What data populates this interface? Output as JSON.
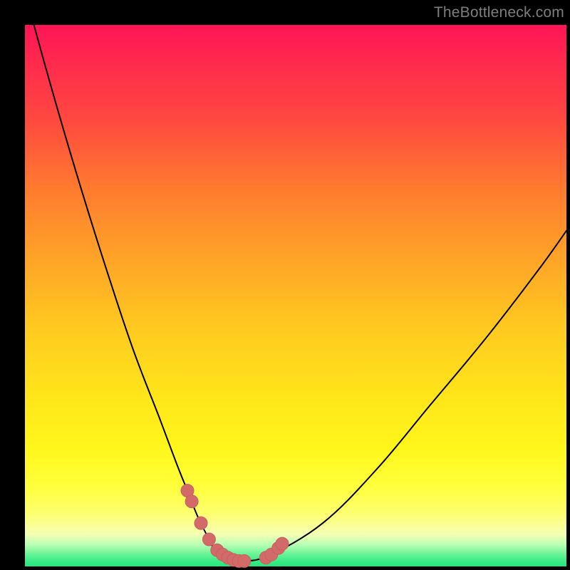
{
  "watermark": "TheBottleneck.com",
  "colors": {
    "frame": "#000000",
    "curve_stroke": "#000000",
    "marker_fill": "#d36a6a",
    "marker_stroke": "#c85f5f"
  },
  "chart_data": {
    "type": "line",
    "title": "",
    "xlabel": "",
    "ylabel": "",
    "xlim": [
      0,
      100
    ],
    "ylim": [
      0,
      100
    ],
    "grid": false,
    "legend": false,
    "note": "Axes are implied (no tick labels visible). x and y in percent of plot area; y=0 at bottom, y=100 at top.",
    "series": [
      {
        "name": "bottleneck-curve",
        "x": [
          0,
          5,
          10,
          15,
          20,
          25,
          28,
          30,
          32,
          34,
          35,
          36,
          38,
          40,
          45,
          55,
          65,
          75,
          85,
          95,
          100
        ],
        "y": [
          106,
          88,
          71,
          55,
          40,
          27,
          19,
          14,
          9,
          5,
          3,
          2,
          1,
          1,
          2,
          8,
          18,
          30,
          42,
          55,
          62
        ]
      }
    ],
    "markers": {
      "name": "highlight-points",
      "x": [
        30.0,
        30.8,
        32.5,
        34.0,
        35.5,
        36.5,
        37.5,
        38.5,
        39.5,
        40.5,
        44.5,
        45.5,
        46.8,
        47.5
      ],
      "y": [
        14.0,
        12.0,
        8.0,
        5.0,
        3.0,
        2.2,
        1.6,
        1.2,
        1.0,
        1.0,
        1.6,
        2.2,
        3.4,
        4.2
      ],
      "radius_px": 9
    },
    "background_gradient": {
      "direction": "top-to-bottom",
      "stops": [
        {
          "pos": 0.0,
          "color": "#ff1456"
        },
        {
          "pos": 0.3,
          "color": "#ff7a2f"
        },
        {
          "pos": 0.68,
          "color": "#ffe41a"
        },
        {
          "pos": 0.9,
          "color": "#feff6c"
        },
        {
          "pos": 0.96,
          "color": "#b7ffb4"
        },
        {
          "pos": 1.0,
          "color": "#1fe67a"
        }
      ]
    }
  }
}
